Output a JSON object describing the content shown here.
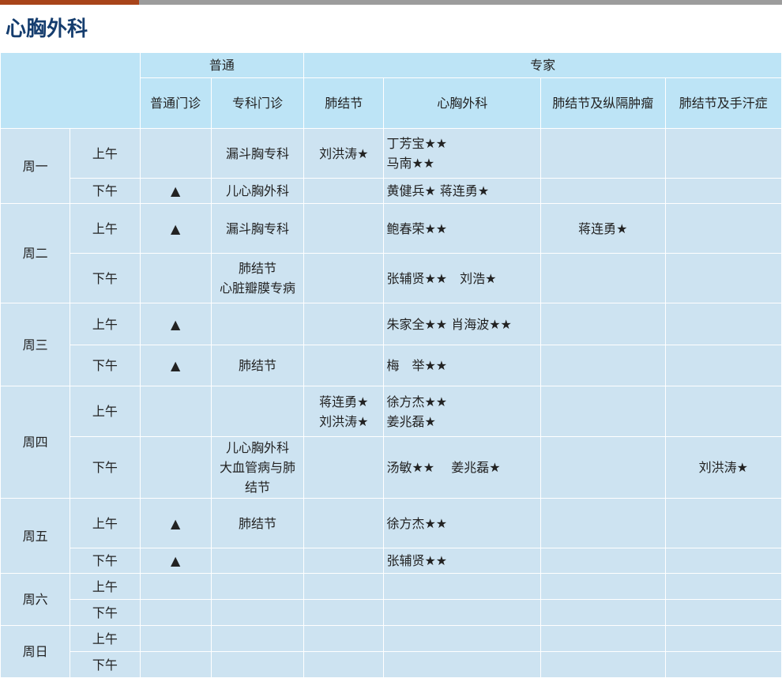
{
  "page_title": "心胸外科",
  "colors": {
    "accent": "#a8441a",
    "title": "#153d6e",
    "header_bg": "#bde4f6",
    "cell_bg": "#cde3f1"
  },
  "header": {
    "group_general": "普通",
    "group_expert": "专家",
    "columns": [
      "普通门诊",
      "专科门诊",
      "肺结节",
      "心胸外科",
      "肺结节及纵隔肿瘤",
      "肺结节及手汗症"
    ]
  },
  "days": [
    {
      "name": "周一",
      "slots": [
        {
          "period": "上午",
          "cells": [
            "",
            "漏斗胸专科",
            "刘洪涛★",
            "丁芳宝★★\n马南★★",
            "",
            ""
          ]
        },
        {
          "period": "下午",
          "cells": [
            "▲",
            "儿心胸外科",
            "",
            "黄健兵★ 蒋连勇★",
            "",
            ""
          ]
        }
      ]
    },
    {
      "name": "周二",
      "slots": [
        {
          "period": "上午",
          "cells": [
            "▲",
            "漏斗胸专科",
            "",
            "鲍春荣★★",
            "蒋连勇★",
            ""
          ]
        },
        {
          "period": "下午",
          "cells": [
            "",
            "肺结节\n心脏瓣膜专病",
            "",
            "张辅贤★★　刘浩★",
            "",
            ""
          ]
        }
      ]
    },
    {
      "name": "周三",
      "slots": [
        {
          "period": "上午",
          "cells": [
            "▲",
            "",
            "",
            "朱家全★★  肖海波★★",
            "",
            ""
          ]
        },
        {
          "period": "下午",
          "cells": [
            "▲",
            "肺结节",
            "",
            "梅　举★★",
            "",
            ""
          ]
        }
      ]
    },
    {
      "name": "周四",
      "slots": [
        {
          "period": "上午",
          "cells": [
            "",
            "",
            "蒋连勇★\n刘洪涛★",
            "徐方杰★★\n姜兆磊★",
            "",
            ""
          ]
        },
        {
          "period": "下午",
          "cells": [
            "",
            "儿心胸外科\n大血管病与肺\n结节",
            "",
            "汤敏★★　 姜兆磊★",
            "",
            "刘洪涛★"
          ]
        }
      ]
    },
    {
      "name": "周五",
      "slots": [
        {
          "period": "上午",
          "cells": [
            "▲",
            "肺结节",
            "",
            "徐方杰★★",
            "",
            ""
          ]
        },
        {
          "period": "下午",
          "cells": [
            "▲",
            "",
            "",
            "张辅贤★★",
            "",
            ""
          ]
        }
      ]
    },
    {
      "name": "周六",
      "slots": [
        {
          "period": "上午",
          "cells": [
            "",
            "",
            "",
            "",
            "",
            ""
          ]
        },
        {
          "period": "下午",
          "cells": [
            "",
            "",
            "",
            "",
            "",
            ""
          ]
        }
      ]
    },
    {
      "name": "周日",
      "slots": [
        {
          "period": "上午",
          "cells": [
            "",
            "",
            "",
            "",
            "",
            ""
          ]
        },
        {
          "period": "下午",
          "cells": [
            "",
            "",
            "",
            "",
            "",
            ""
          ]
        }
      ]
    }
  ]
}
